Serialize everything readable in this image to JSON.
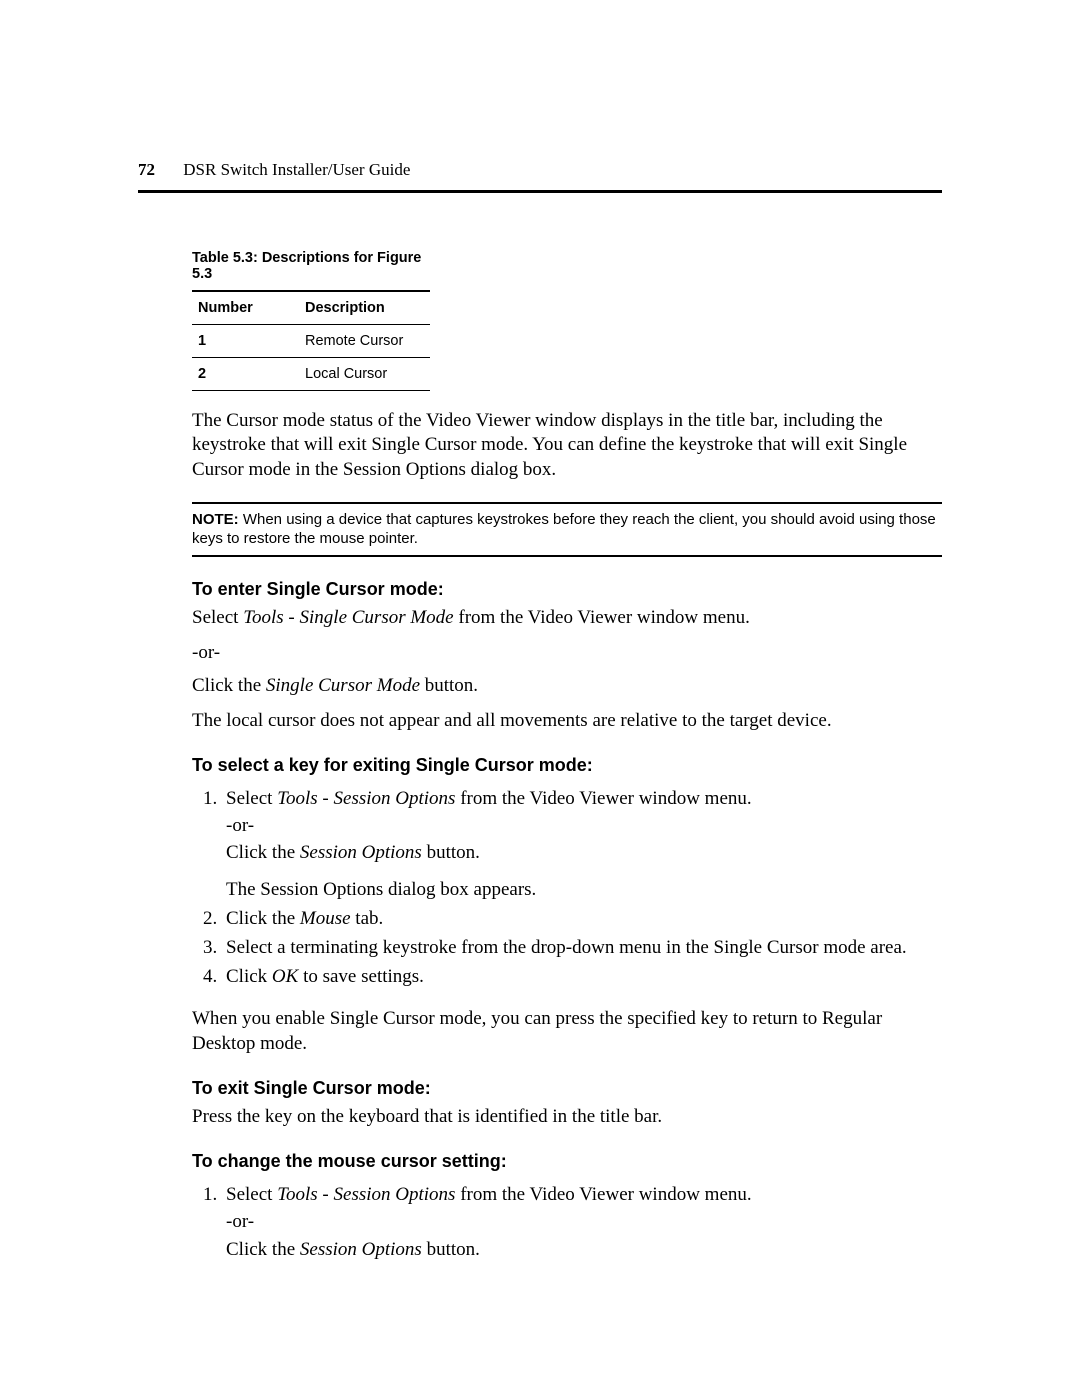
{
  "header": {
    "page_number": "72",
    "title": "DSR Switch Installer/User Guide"
  },
  "table": {
    "caption": "Table 5.3: Descriptions for Figure 5.3",
    "headers": [
      "Number",
      "Description"
    ],
    "rows": [
      {
        "num": "1",
        "desc": "Remote Cursor"
      },
      {
        "num": "2",
        "desc": "Local Cursor"
      }
    ]
  },
  "para_cursor_mode": "The Cursor mode status of the Video Viewer window displays in the title bar, including the keystroke that will exit Single Cursor mode. You can define the keystroke that will exit Single Cursor mode in the Session Options dialog box.",
  "note": {
    "label": "NOTE:",
    "text": " When using a device that captures keystrokes before they reach the client, you should avoid using those keys to restore the mouse pointer."
  },
  "h_enter": "To enter Single Cursor mode:",
  "enter": {
    "line1_pre": "Select ",
    "line1_em": "Tools - Single Cursor Mode",
    "line1_post": " from the Video Viewer window menu.",
    "or": "-or-",
    "line2_pre": "Click the ",
    "line2_em": "Single Cursor Mode",
    "line2_post": " button.",
    "line3": "The local cursor does not appear and all movements are relative to the target device."
  },
  "h_select": "To select a key for exiting Single Cursor mode:",
  "select_steps": {
    "s1_pre": "Select ",
    "s1_em": "Tools - Session Options",
    "s1_post": " from the Video Viewer window menu.",
    "s1_or": "-or-",
    "s1b_pre": "Click the ",
    "s1b_em": "Session Options",
    "s1b_post": " button.",
    "s1c": "The Session Options dialog box appears.",
    "s2_pre": "Click the ",
    "s2_em": "Mouse",
    "s2_post": " tab.",
    "s3": "Select a terminating keystroke from the drop-down menu in the Single Cursor mode area.",
    "s4_pre": "Click ",
    "s4_em": "OK",
    "s4_post": " to save settings."
  },
  "para_after_select": "When you enable Single Cursor mode, you can press the specified key to return to Regular Desktop mode.",
  "h_exit": "To exit Single Cursor mode:",
  "exit_text": "Press the key on the keyboard that is identified in the title bar.",
  "h_change": "To change the mouse cursor setting:",
  "change_steps": {
    "s1_pre": "Select ",
    "s1_em": "Tools - Session Options",
    "s1_post": " from the Video Viewer window menu.",
    "s1_or": "-or-",
    "s1b_pre": "Click the ",
    "s1b_em": "Session Options",
    "s1b_post": " button."
  }
}
